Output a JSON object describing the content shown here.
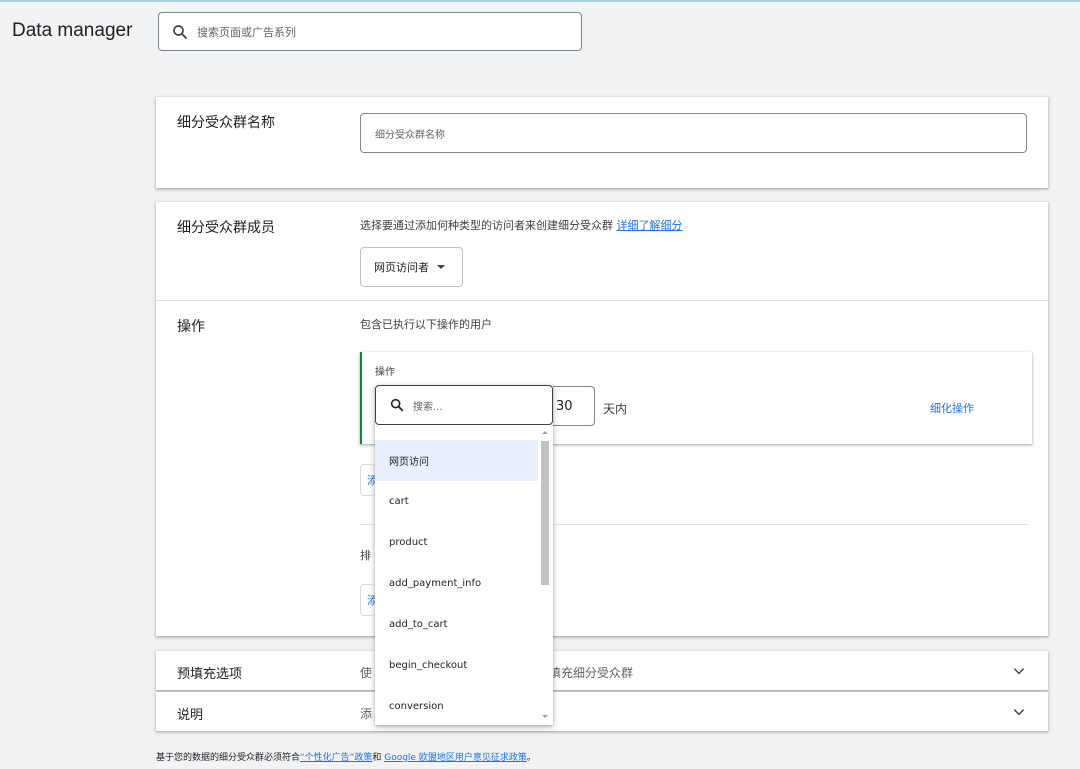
{
  "app": {
    "title": "Data manager"
  },
  "top_search": {
    "placeholder": "搜索页面或广告系列"
  },
  "segment_name": {
    "label": "细分受众群名称",
    "placeholder": "细分受众群名称"
  },
  "members": {
    "label": "细分受众群成员",
    "description": "选择要通过添加何种类型的访问者来创建细分受众群",
    "learn_more": "详细了解细分",
    "visitor_type": "网页访问者"
  },
  "actions": {
    "label": "操作",
    "description": "包含已执行以下操作的用户",
    "box_label": "操作",
    "days_value": "30",
    "days_suffix": "天内",
    "refine": "细化操作",
    "add_partial_1": "添",
    "exclude_partial": "排",
    "add_partial_2": "添"
  },
  "dropdown": {
    "search_placeholder": "搜索...",
    "items": [
      "网页访问",
      "cart",
      "product",
      "add_payment_info",
      "add_to_cart",
      "begin_checkout",
      "conversion"
    ],
    "selected_index": 0
  },
  "prefill": {
    "label": "预填充选项",
    "desc_start": "使",
    "desc_end": "填充细分受众群"
  },
  "notes": {
    "label": "说明",
    "desc_start": "添"
  },
  "footer": {
    "text1": "基于您的数据的细分受众群必须符合",
    "link1": "“个性化广告”政策",
    "text2": "和 ",
    "link2": "Google 欧盟地区用户意见征求政策",
    "text3": "。"
  },
  "icons": {
    "search": "search-icon",
    "caret": "caret-down-icon",
    "chevron": "chevron-down-icon"
  },
  "colors": {
    "accent": "#1a73e8",
    "action_border": "#188038",
    "selected_bg": "#e8f0fe"
  }
}
